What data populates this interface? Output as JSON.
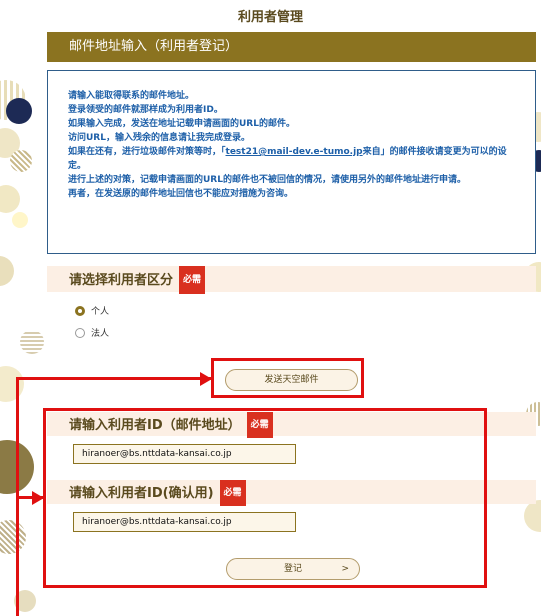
{
  "page": {
    "title": "利用者管理"
  },
  "form": {
    "header": "邮件地址输入（利用者登记）"
  },
  "notice": {
    "lines": [
      "请输入能取得联系的邮件地址。",
      "登录领受的邮件就那样成为利用者ID。",
      "如果输入完成，发送在地址记载申请画面的URL的邮件。",
      "访问URL，输入残余的信息请让我完成登录。"
    ],
    "line5_pre": "如果在还有，进行垃圾邮件对策等时，「",
    "line5_link": "test21@mail-dev.e-tumo.jp",
    "line5_post": "来自」的邮件接收请变更为可以的设定。",
    "line6": "进行上述的对策，记载申请画面的URL的邮件也不被回信的情况，请使用另外的邮件地址进行申请。",
    "line7": "再者，在发送原的邮件地址回信也不能应对措施为咨询。"
  },
  "user_type": {
    "label": "请选择利用者区分",
    "required": "必需",
    "options": [
      "个人",
      "法人"
    ],
    "selected": "个人"
  },
  "send_empty_mail_button": "发送天空邮件",
  "email_section": {
    "label": "请输入利用者ID（邮件地址）",
    "required": "必需",
    "value": "hiranoer@bs.nttdata-kansai.co.jp"
  },
  "confirm_section": {
    "label": "请输入利用者ID(确认用)",
    "required": "必需",
    "value": "hiranoer@bs.nttdata-kansai.co.jp"
  },
  "register_button": {
    "label": "登记",
    "arrow": ">"
  },
  "colors": {
    "brand": "#8b7320",
    "notice_text": "#1d5fa8",
    "highlight": "#e01010",
    "required_badge": "#d9301f"
  }
}
